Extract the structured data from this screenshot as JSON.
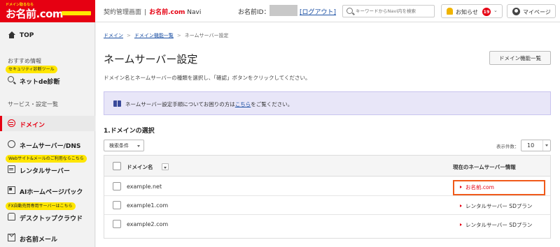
{
  "header": {
    "logo_tagline": "ドメイン取るなら",
    "logo_name": "お名前.com",
    "contract_mgmt": "契約管理画面",
    "separator": "|",
    "brand_name": "お名前.com",
    "brand_suffix": "Navi",
    "id_label": "お名前ID：",
    "logout": "[ログアウト]",
    "search_placeholder": "キーワードからNavi内を検索",
    "notice_label": "お知らせ",
    "notice_count": "19",
    "mypage_label": "マイページ"
  },
  "sidebar": {
    "top": "TOP",
    "recommend_section": "おすすめ情報",
    "security_pill": "セキュリティ診断ツール",
    "net_de_shindan": "ネットde診断",
    "services_section": "サービス・設定一覧",
    "domain": "ドメイン",
    "nameserver_dns": "ネームサーバー/DNS",
    "web_mail_pill": "Webサイト&メールのご利用ならこちら",
    "rental_server": "レンタルサーバー",
    "ai_homepage": "AIホームページパック",
    "fx_pill": "FX自動売買専用サーバーはこちら",
    "desktop_cloud": "デスクトップクラウド",
    "onamae_mail": "お名前メール"
  },
  "main": {
    "breadcrumb": [
      "ドメイン",
      "ドメイン機能一覧",
      "ネームサーバー設定"
    ],
    "breadcrumb_sep": ">",
    "title": "ネームサーバー設定",
    "domain_features_button": "ドメイン機能一覧",
    "description": "ドメイン名とネームサーバーの種類を選択し、「確認」ボタンをクリックしてください。",
    "info_before": "ネームサーバー設定手順についてお困りの方は",
    "info_link": "こちら",
    "info_after": "をご覧ください。",
    "section_title": "1.ドメインの選択",
    "filter_label": "検索条件",
    "per_page_label": "表示件数：",
    "per_page_value": "10",
    "table": {
      "col_domain": "ドメイン名",
      "col_ns": "現在のネームサーバー情報",
      "rows": [
        {
          "domain": "example.net",
          "ns": "お名前.com",
          "highlighted": true
        },
        {
          "domain": "example1.com",
          "ns": "レンタルサーバー SDプラン",
          "highlighted": false
        },
        {
          "domain": "example2.com",
          "ns": "レンタルサーバー SDプラン",
          "highlighted": false
        }
      ]
    }
  },
  "colors": {
    "brand_red": "#e60012",
    "brand_yellow": "#ffe600",
    "link_blue": "#1a4fa3",
    "highlight_orange": "#f05a1a",
    "info_bg": "#e8e6f8"
  }
}
